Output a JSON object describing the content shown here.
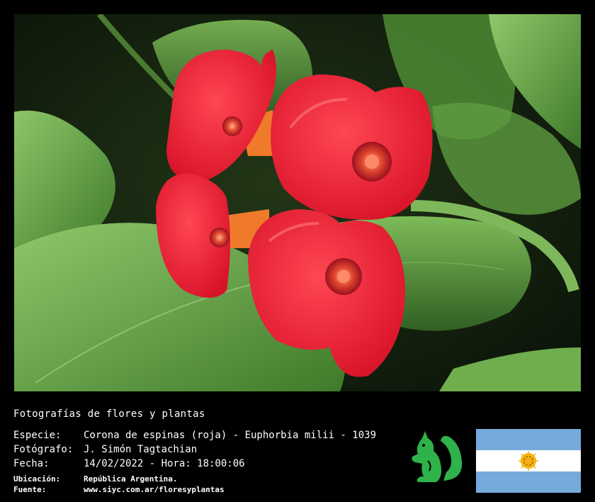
{
  "header": {
    "title": "Fotografías de flores y plantas"
  },
  "details": {
    "especie_label": "Especie:",
    "especie_value": "Corona de espinas (roja) - Euphorbia milii - 1039",
    "fotografo_label": "Fotógrafo:",
    "fotografo_value": "J. Simón Tagtachian",
    "fecha_label": "Fecha:",
    "fecha_value": "14/02/2022 - Hora: 18:00:06",
    "ubicacion_label": "Ubicación:",
    "ubicacion_value": "República Argentina.",
    "fuente_label": "Fuente:",
    "fuente_value": "www.siyc.com.ar/floresyplantas"
  },
  "colors": {
    "flower_red": "#f0283a",
    "flower_center": "#c41a24",
    "leaf_green": "#6fae4d",
    "mascot_green": "#2fb24a",
    "flag_blue": "#75aadb",
    "flag_sun": "#f6b40e"
  },
  "icons": {
    "mascot": "squirrel-icon",
    "flag": "argentina-flag-icon"
  }
}
